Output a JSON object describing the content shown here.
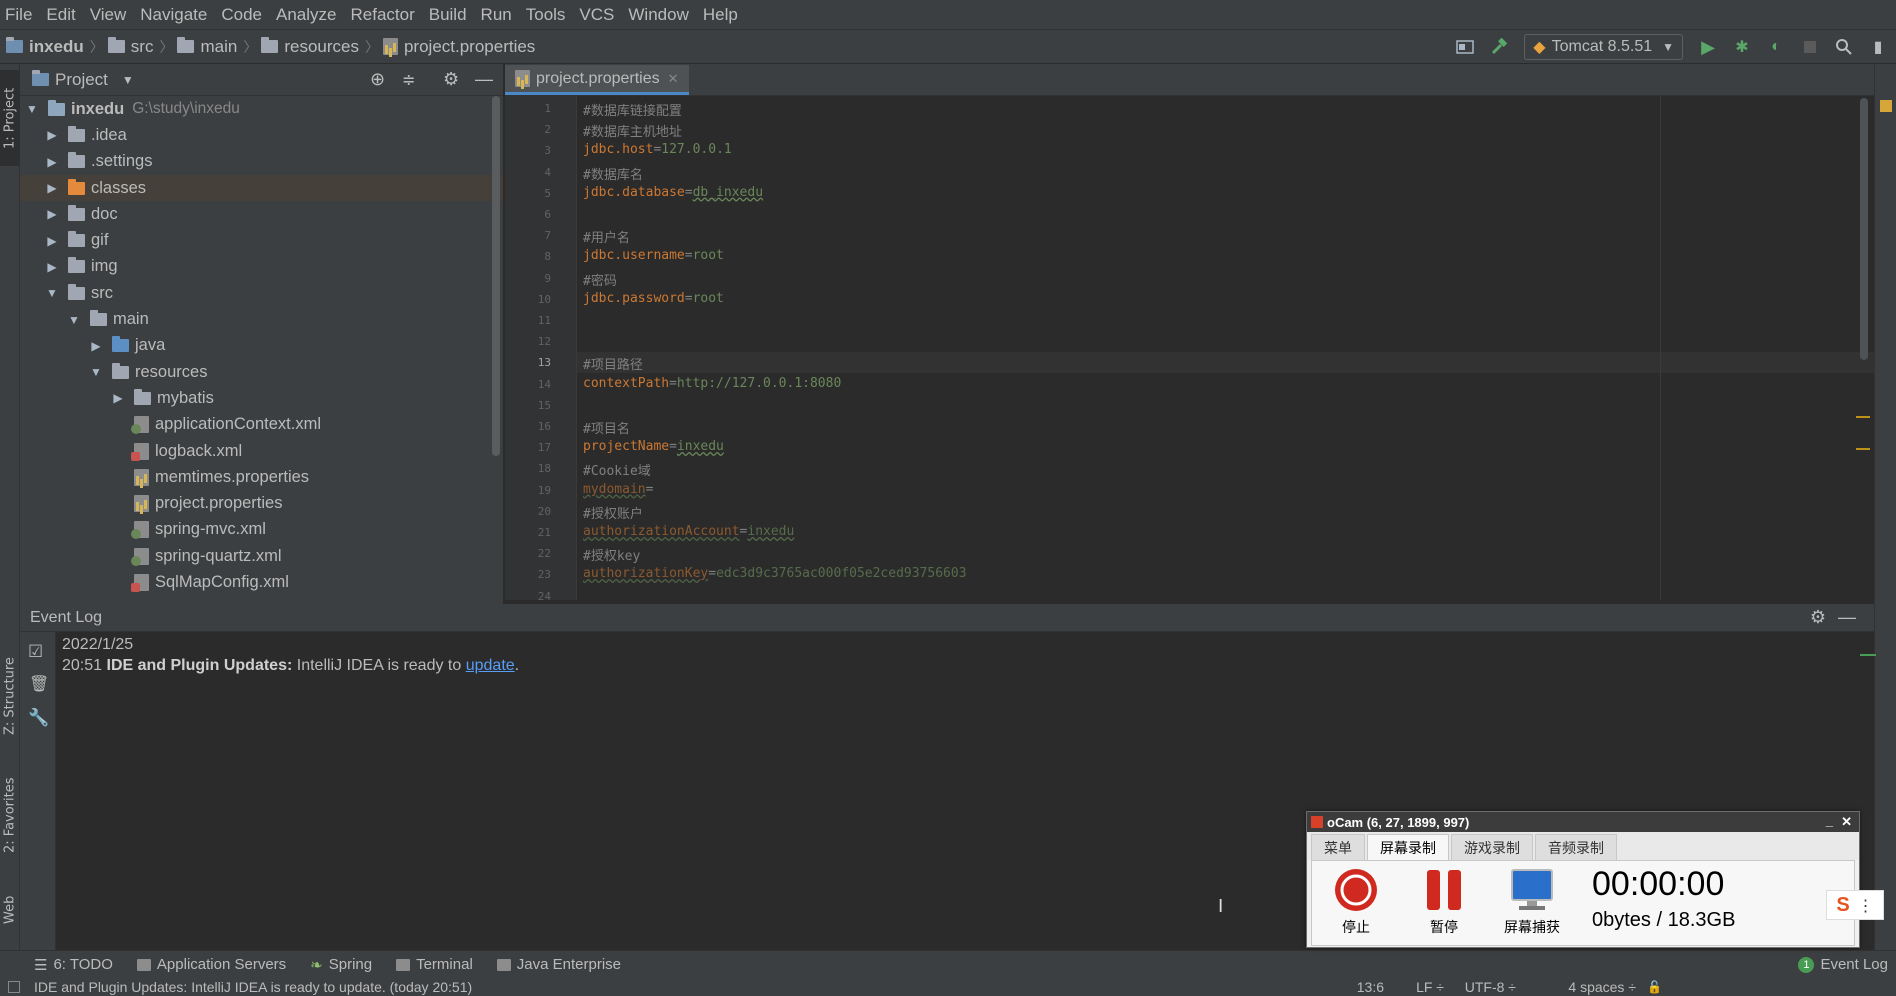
{
  "menu": [
    "File",
    "Edit",
    "View",
    "Navigate",
    "Code",
    "Analyze",
    "Refactor",
    "Build",
    "Run",
    "Tools",
    "VCS",
    "Window",
    "Help"
  ],
  "breadcrumb": [
    "inxedu",
    "src",
    "main",
    "resources",
    "project.properties"
  ],
  "run_config": "Tomcat 8.5.51",
  "left_tabs": {
    "project": "1: Project",
    "structure": "Z: Structure",
    "favorites": "2: Favorites",
    "web": "Web"
  },
  "project_panel": {
    "title": "Project",
    "root_name": "inxedu",
    "root_path": "G:\\study\\inxedu",
    "items": [
      ".idea",
      ".settings",
      "classes",
      "doc",
      "gif",
      "img",
      "src",
      "main",
      "java",
      "resources",
      "mybatis",
      "applicationContext.xml",
      "logback.xml",
      "memtimes.properties",
      "project.properties",
      "spring-mvc.xml",
      "spring-quartz.xml",
      "SqlMapConfig.xml"
    ]
  },
  "editor": {
    "tab": "project.properties",
    "current_line": "13",
    "lines": [
      {
        "n": "1",
        "type": "comment",
        "text": "#数据库链接配置"
      },
      {
        "n": "2",
        "type": "comment",
        "text": "#数据库主机地址"
      },
      {
        "n": "3",
        "type": "kv",
        "key": "jdbc.host",
        "value": "127.0.0.1"
      },
      {
        "n": "4",
        "type": "comment",
        "text": "#数据库名"
      },
      {
        "n": "5",
        "type": "kv",
        "key": "jdbc.database",
        "value": "db_inxedu"
      },
      {
        "n": "6",
        "type": "empty"
      },
      {
        "n": "7",
        "type": "comment",
        "text": "#用户名"
      },
      {
        "n": "8",
        "type": "kv",
        "key": "jdbc.username",
        "value": "root"
      },
      {
        "n": "9",
        "type": "comment",
        "text": "#密码"
      },
      {
        "n": "10",
        "type": "kv",
        "key": "jdbc.password",
        "value": "root"
      },
      {
        "n": "11",
        "type": "empty"
      },
      {
        "n": "12",
        "type": "empty"
      },
      {
        "n": "13",
        "type": "comment",
        "text": "#项目路径"
      },
      {
        "n": "14",
        "type": "kv",
        "key": "contextPath",
        "value": "http://127.0.0.1:8080"
      },
      {
        "n": "15",
        "type": "empty"
      },
      {
        "n": "16",
        "type": "comment",
        "text": "#项目名"
      },
      {
        "n": "17",
        "type": "kv",
        "key": "projectName",
        "value": "inxedu"
      },
      {
        "n": "18",
        "type": "comment",
        "text": "#Cookie域"
      },
      {
        "n": "19",
        "type": "kv",
        "key": "mydomain",
        "value": ""
      },
      {
        "n": "20",
        "type": "comment",
        "text": "#授权账户"
      },
      {
        "n": "21",
        "type": "kv",
        "key": "authorizationAccount",
        "value": "inxedu"
      },
      {
        "n": "22",
        "type": "comment",
        "text": "#授权key"
      },
      {
        "n": "23",
        "type": "kv",
        "key": "authorizationKey",
        "value": "edc3d9c3765ac000f05e2ced93756603"
      },
      {
        "n": "24",
        "type": "empty"
      }
    ]
  },
  "event_log": {
    "title": "Event Log",
    "date": "2022/1/25",
    "time": "20:51",
    "heading": "IDE and Plugin Updates:",
    "message": "IntelliJ IDEA is ready to",
    "link": "update",
    "suffix": "."
  },
  "bottom_tabs": [
    {
      "label": "6: TODO"
    },
    {
      "label": "Application Servers"
    },
    {
      "label": "Spring"
    },
    {
      "label": "Terminal"
    },
    {
      "label": "Java Enterprise"
    }
  ],
  "event_log_button": "Event Log",
  "event_log_count": "1",
  "status": {
    "message": "IDE and Plugin Updates: IntelliJ IDEA is ready to update. (today 20:51)",
    "position": "13:6",
    "line_sep": "LF ÷",
    "encoding": "UTF-8 ÷",
    "indent": "4 spaces ÷"
  },
  "ocam": {
    "title": "oCam (6, 27, 1899, 997)",
    "tabs": [
      "菜单",
      "屏幕录制",
      "游戏录制",
      "音频录制"
    ],
    "active_tab": "屏幕录制",
    "stop": "停止",
    "pause": "暂停",
    "capture": "屏幕捕获",
    "timer": "00:00:00",
    "size": "0bytes / 18.3GB"
  },
  "colors": {
    "bg": "#2b2b2b",
    "panel": "#3c3f41",
    "comment": "#808080",
    "key": "#cc7832",
    "value": "#6a8759",
    "link": "#589df6"
  }
}
